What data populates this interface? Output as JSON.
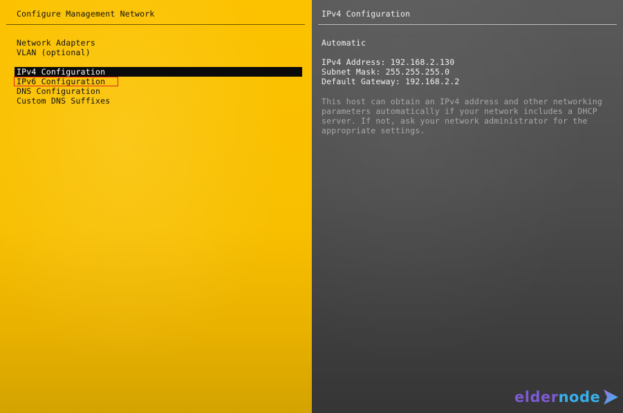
{
  "left_panel": {
    "title": "Configure Management Network",
    "menu": [
      {
        "label": "Network Adapters",
        "selected": false
      },
      {
        "label": "VLAN (optional)",
        "selected": false
      },
      {
        "label": "IPv4 Configuration",
        "selected": true
      },
      {
        "label": "IPv6 Configuration",
        "selected": false
      },
      {
        "label": "DNS Configuration",
        "selected": false
      },
      {
        "label": "Custom DNS Suffixes",
        "selected": false
      }
    ]
  },
  "right_panel": {
    "title": "IPv4 Configuration",
    "mode": "Automatic",
    "ipv4_address": "IPv4 Address: 192.168.2.130",
    "subnet_mask": "Subnet Mask: 255.255.255.0",
    "default_gateway": "Default Gateway: 192.168.2.2",
    "help_lines": [
      "This host can obtain an IPv4 address and other networking",
      "parameters automatically if your network includes a DHCP",
      "server. If not, ask your network administrator for the",
      "appropriate settings."
    ]
  },
  "logo": {
    "part1": "elder",
    "part2": "node",
    "icon": "play-arrow-icon"
  },
  "colors": {
    "left_bg": "#fcc200",
    "right_bg": "#4d4d4d",
    "selection_bg": "#0a0a0a",
    "annotation_box": "#e0201b",
    "logo_purple": "#7d5bd4",
    "logo_blue": "#38b0ec"
  }
}
